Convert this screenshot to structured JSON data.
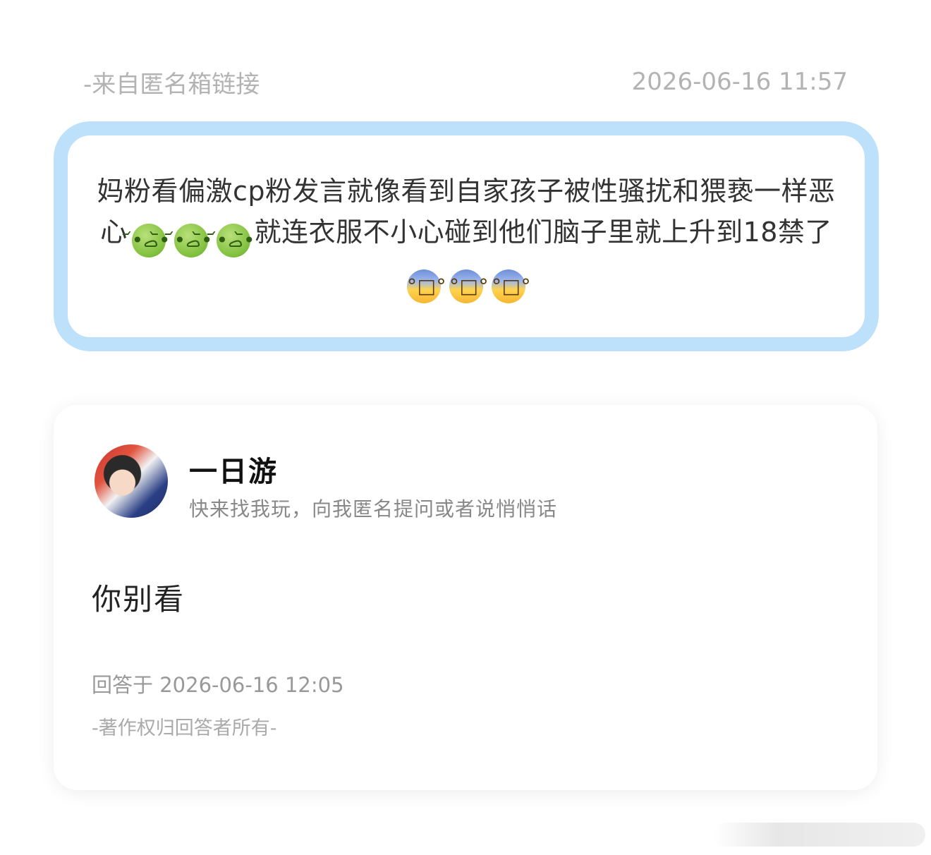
{
  "question": {
    "source": "-来自匿名箱链接",
    "timestamp": "2026-06-16 11:57",
    "text_part1": "妈粉看偏激cp粉发言就像看到自家孩子被性骚扰和猥亵一样恶心",
    "text_part2": "就连衣服不小心碰到他们脑子里就上升到18禁了",
    "emoji_group1": [
      "nauseated-face",
      "nauseated-face",
      "nauseated-face"
    ],
    "emoji_group2": [
      "anxious-face-with-sweat",
      "anxious-face-with-sweat",
      "anxious-face-with-sweat"
    ],
    "border_color": "#bde0fb"
  },
  "answer": {
    "user_name": "一日游",
    "user_tagline": "快来找我玩，向我匿名提问或者说悄悄话",
    "text": "你别看",
    "answered_at": "回答于 2026-06-16 12:05",
    "copyright": "-著作权归回答者所有-"
  }
}
